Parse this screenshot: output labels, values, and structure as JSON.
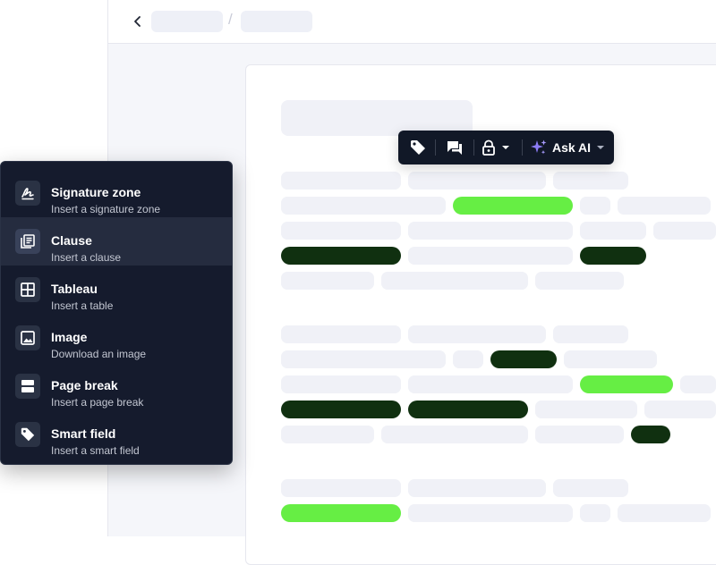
{
  "toolbar": {
    "ask_ai_label": "Ask AI",
    "icons": [
      "tag-icon",
      "comment-icon",
      "lock-icon",
      "sparkle-icon"
    ]
  },
  "menu": {
    "items": [
      {
        "title": "Signature zone",
        "subtitle": "Insert a signature zone",
        "icon": "signature-icon",
        "active": false
      },
      {
        "title": "Clause",
        "subtitle": "Insert a clause",
        "icon": "clause-icon",
        "active": true
      },
      {
        "title": "Tableau",
        "subtitle": "Insert a table",
        "icon": "table-icon",
        "active": false
      },
      {
        "title": "Image",
        "subtitle": "Download an image",
        "icon": "image-icon",
        "active": false
      },
      {
        "title": "Page break",
        "subtitle": "Insert a page break",
        "icon": "page-break-icon",
        "active": false
      },
      {
        "title": "Smart field",
        "subtitle": "Insert a smart field",
        "icon": "tag-icon",
        "active": false
      }
    ]
  },
  "colors": {
    "menu_bg": "#151b2d",
    "menu_active": "#252c3f",
    "highlight_bright": "#66ee44",
    "highlight_dark": "#103010",
    "placeholder": "#f0f1f7",
    "ai_accent": "#8b7cf6"
  }
}
